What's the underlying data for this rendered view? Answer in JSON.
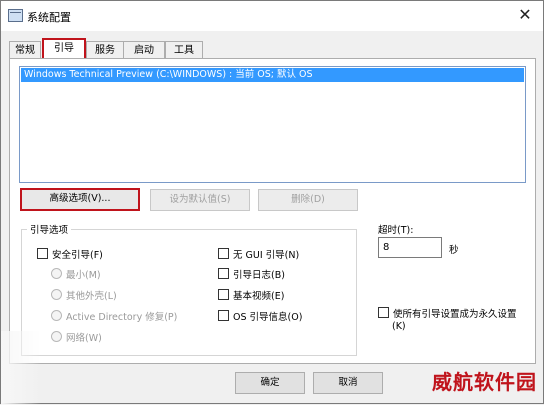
{
  "window": {
    "title": "系统配置",
    "close": "✕"
  },
  "tabs": [
    {
      "label": "常规"
    },
    {
      "label": "引导"
    },
    {
      "label": "服务"
    },
    {
      "label": "启动"
    },
    {
      "label": "工具"
    }
  ],
  "boot_list": {
    "items": [
      "Windows Technical Preview (C:\\WINDOWS) : 当前 OS; 默认 OS"
    ]
  },
  "boot_buttons": {
    "advanced": "高级选项(V)...",
    "set_default": "设为默认值(S)",
    "delete": "删除(D)"
  },
  "boot_options": {
    "title": "引导选项",
    "safe_boot": "安全引导(F)",
    "minimal": "最小(M)",
    "alternate_shell": "其他外壳(L)",
    "ad_repair": "Active Directory 修复(P)",
    "network": "网络(W)",
    "no_gui": "无 GUI 引导(N)",
    "boot_log": "引导日志(B)",
    "base_video": "基本视频(E)",
    "os_info": "OS 引导信息(O)"
  },
  "timeout": {
    "label": "超时(T):",
    "value": "8",
    "unit": "秒"
  },
  "permanent": {
    "line1": "使所有引导设置成为永久设置",
    "line2": "(K)"
  },
  "footer": {
    "ok": "确定",
    "cancel": "取消"
  },
  "watermark": "威航软件园"
}
